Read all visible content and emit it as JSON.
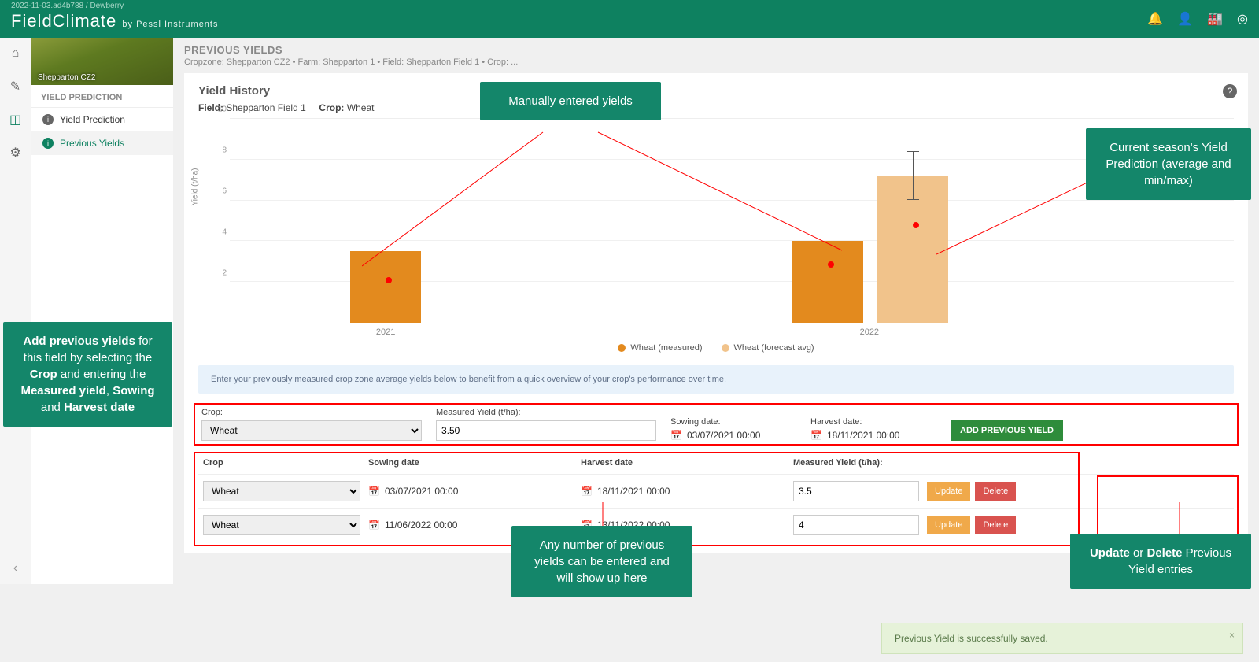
{
  "topbar": {
    "meta": "2022-11-03.ad4b788 / Dewberry",
    "brand_main": "FieldClimate",
    "brand_sub": "by Pessl Instruments"
  },
  "sidebar": {
    "hero_caption": "Shepparton CZ2",
    "section": "YIELD PREDICTION",
    "items": [
      {
        "label": "Yield Prediction"
      },
      {
        "label": "Previous Yields"
      }
    ]
  },
  "crumbs": {
    "title": "PREVIOUS YIELDS",
    "path": "Cropzone: Shepparton CZ2 • Farm: Shepparton 1 • Field: Shepparton Field 1 • Crop: ..."
  },
  "card": {
    "title": "Yield History",
    "field_label": "Field:",
    "field_value": "Shepparton Field 1",
    "crop_label": "Crop:",
    "crop_value": "Wheat",
    "ylabel": "Yield (t/ha)",
    "legend_measured": "Wheat (measured)",
    "legend_forecast": "Wheat (forecast avg)"
  },
  "chart_data": {
    "type": "bar",
    "ylabel": "Yield (t/ha)",
    "ylim": [
      0,
      10
    ],
    "yticks": [
      2,
      4,
      6,
      8,
      10
    ],
    "categories": [
      "2021",
      "2022"
    ],
    "series": [
      {
        "name": "Wheat (measured)",
        "color": "#e38a1e",
        "values": [
          3.5,
          4.0
        ]
      },
      {
        "name": "Wheat (forecast avg)",
        "color": "#f1c38b",
        "values": [
          null,
          7.2
        ],
        "errors": [
          [
            null,
            null
          ],
          [
            6.0,
            8.4
          ]
        ]
      }
    ],
    "legend": [
      "Wheat (measured)",
      "Wheat (forecast avg)"
    ]
  },
  "info_banner": "Enter your previously measured crop zone average yields below to benefit from a quick overview of your crop's performance over time.",
  "form": {
    "crop_label": "Crop:",
    "crop_value": "Wheat",
    "yield_label": "Measured Yield (t/ha):",
    "yield_value": "3.50",
    "sowing_label": "Sowing date:",
    "sowing_value": "03/07/2021 00:00",
    "harvest_label": "Harvest date:",
    "harvest_value": "18/11/2021 00:00",
    "add_btn": "ADD PREVIOUS YIELD"
  },
  "table": {
    "headers": {
      "crop": "Crop",
      "sowing": "Sowing date",
      "harvest": "Harvest date",
      "yield": "Measured Yield (t/ha):"
    },
    "rows": [
      {
        "crop": "Wheat",
        "sowing": "03/07/2021 00:00",
        "harvest": "18/11/2021 00:00",
        "yield": "3.5"
      },
      {
        "crop": "Wheat",
        "sowing": "11/06/2022 00:00",
        "harvest": "13/11/2022 00:00",
        "yield": "4"
      }
    ],
    "update_btn": "Update",
    "delete_btn": "Delete"
  },
  "toast": "Previous Yield is successfully saved.",
  "annotations": {
    "manual": "Manually entered yields",
    "prediction": "Current season's Yield Prediction (average and min/max)",
    "add_html": "<b>Add previous yields</b> for this field by selecting the <b>Crop</b> and entering the <b>Measured yield</b>, <b>Sowing</b> and <b>Harvest date</b>",
    "any_num": "Any number of previous yields can be entered and will show up here",
    "upd_del_html": "<b>Update</b> or <b>Delete</b> Previous Yield entries"
  }
}
